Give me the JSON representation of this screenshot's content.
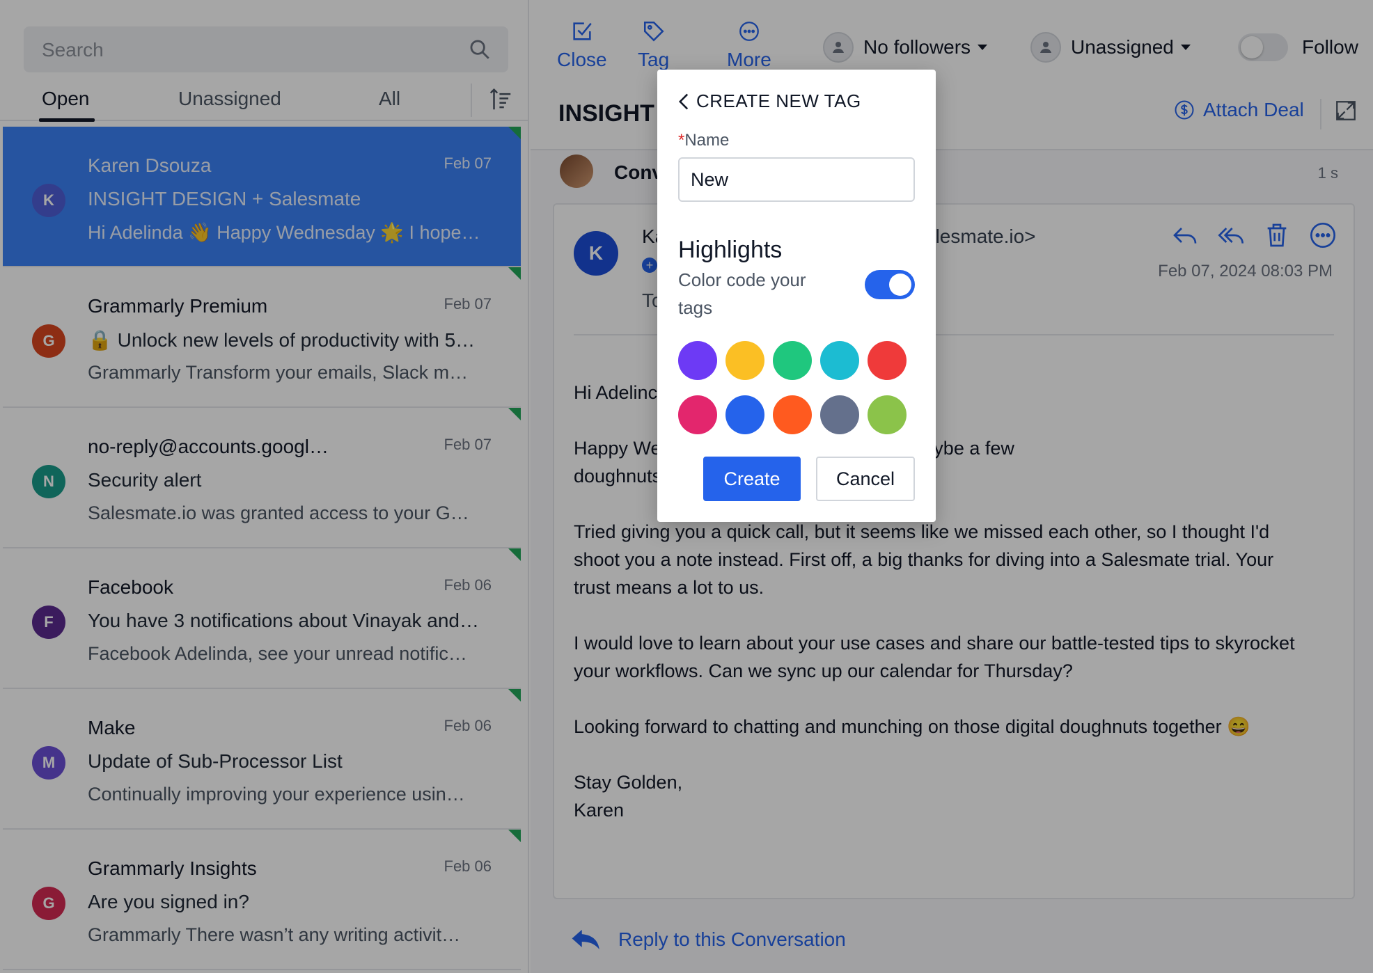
{
  "sidebar": {
    "search_placeholder": "Search",
    "tabs": [
      {
        "label": "Open"
      },
      {
        "label": "Unassigned"
      },
      {
        "label": "All"
      }
    ],
    "items": [
      {
        "initial": "K",
        "avatar_color": "#4f5fd8",
        "sender": "Karen Dsouza",
        "date": "Feb 07",
        "subject": "INSIGHT DESIGN + Salesmate",
        "preview": "Hi Adelinda 👋 Happy Wednesday 🌟 I hope…"
      },
      {
        "initial": "G",
        "avatar_color": "#d9461f",
        "sender": "Grammarly Premium",
        "date": "Feb 07",
        "subject": "🔒 Unlock new levels of productivity with 5…",
        "preview": "Grammarly Transform your emails, Slack m…"
      },
      {
        "initial": "N",
        "avatar_color": "#1a9b8a",
        "sender": "no-reply@accounts.googl…",
        "date": "Feb 07",
        "subject": "Security alert",
        "preview": "Salesmate.io was granted access to your G…"
      },
      {
        "initial": "F",
        "avatar_color": "#5b2a8f",
        "sender": "Facebook",
        "date": "Feb 06",
        "subject": "You have 3 notifications about Vinayak and…",
        "preview": "Facebook Adelinda, see your unread notific…"
      },
      {
        "initial": "M",
        "avatar_color": "#6b4fd6",
        "sender": "Make",
        "date": "Feb 06",
        "subject": "Update of Sub-Processor List",
        "preview": "Continually improving your experience usin…"
      },
      {
        "initial": "G",
        "avatar_color": "#d42a54",
        "sender": "Grammarly Insights",
        "date": "Feb 06",
        "subject": "Are you signed in?",
        "preview": "Grammarly There wasn’t any writing activit…"
      }
    ]
  },
  "toolbar": {
    "close_label": "Close",
    "tag_label": "Tag",
    "more_label": "More",
    "followers_label": "No followers",
    "assignee_label": "Unassigned",
    "follow_label": "Follow"
  },
  "conversation": {
    "title": "INSIGHT",
    "attach_label": "Attach Deal",
    "label": "Conv",
    "time": "1 s"
  },
  "email": {
    "avatar_initial": "K",
    "from_name": "Ka",
    "from_email": "alesmate.io>",
    "to_label": "To",
    "date": "Feb 07, 2024 08:03 PM",
    "body": [
      "Hi Adelinc",
      "Happy We                            buzzing with good vibes and maybe a few\ndoughnuts",
      "Tried giving you a quick call, but it seems like we missed each other, so I thought I'd\nshoot you a note instead. First off, a big thanks for diving into a Salesmate trial. Your\ntrust means a lot to us.",
      "I would love to learn about your use cases and share our battle-tested tips to skyrocket\nyour workflows. Can we sync up our calendar for Thursday?",
      "Looking forward to chatting and munching on those digital doughnuts together 😄",
      "Stay Golden,\nKaren"
    ],
    "reply_label": "Reply to this Conversation"
  },
  "modal": {
    "title": "CREATE NEW TAG",
    "name_label": "Name",
    "required_mark": "*",
    "name_value": "New",
    "highlights_title": "Highlights",
    "highlights_sub": "Color code your tags",
    "highlights_on": true,
    "swatch_colors": [
      "#6d3af5",
      "#fbbf24",
      "#1fc77e",
      "#1cbcd2",
      "#ef3a3a",
      "#e3266d",
      "#2563eb",
      "#ff5a1f",
      "#64708c",
      "#8bc34a"
    ],
    "create_label": "Create",
    "cancel_label": "Cancel"
  }
}
